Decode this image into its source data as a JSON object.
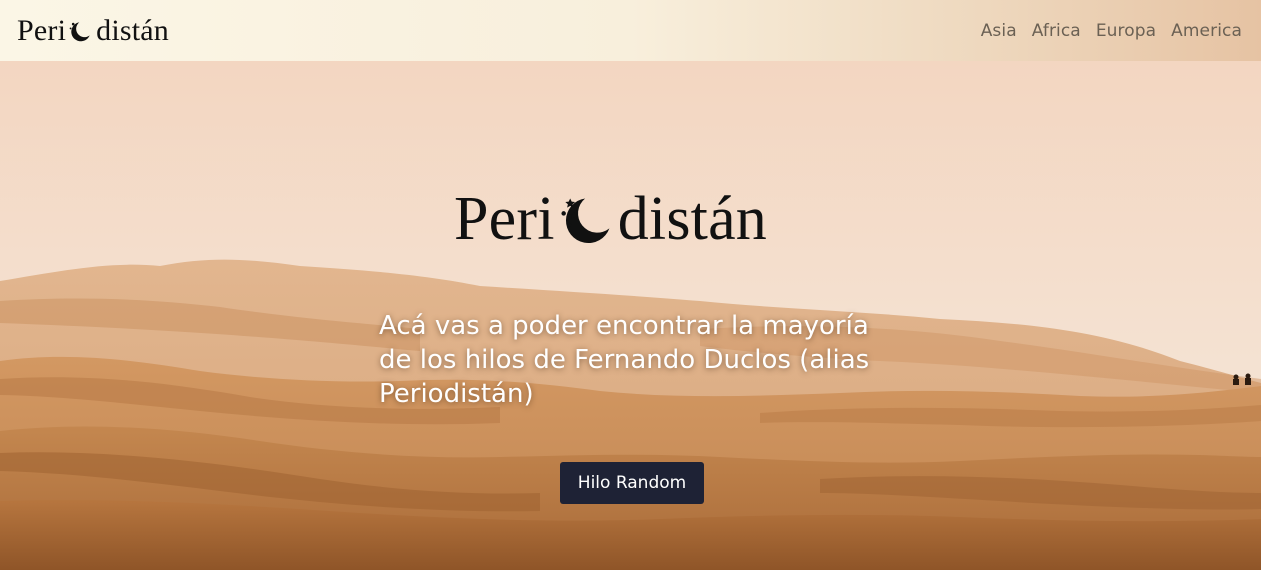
{
  "navbar": {
    "brand": {
      "prefix": "Peri",
      "suffix": "distán"
    },
    "links": [
      "Asia",
      "Africa",
      "Europa",
      "America"
    ]
  },
  "hero": {
    "logo": {
      "prefix": "Peri",
      "suffix": "distán"
    },
    "tagline": "Acá vas a poder encontrar la mayoría de los hilos de Fernando Duclos (alias Periodistán)",
    "button_label": "Hilo Random"
  },
  "colors": {
    "button_bg": "#1e2235",
    "nav_text": "#6b6154",
    "sky": "#f2d7c0",
    "sand": "#c48a56"
  },
  "icons": [
    "moon-stars-icon"
  ]
}
